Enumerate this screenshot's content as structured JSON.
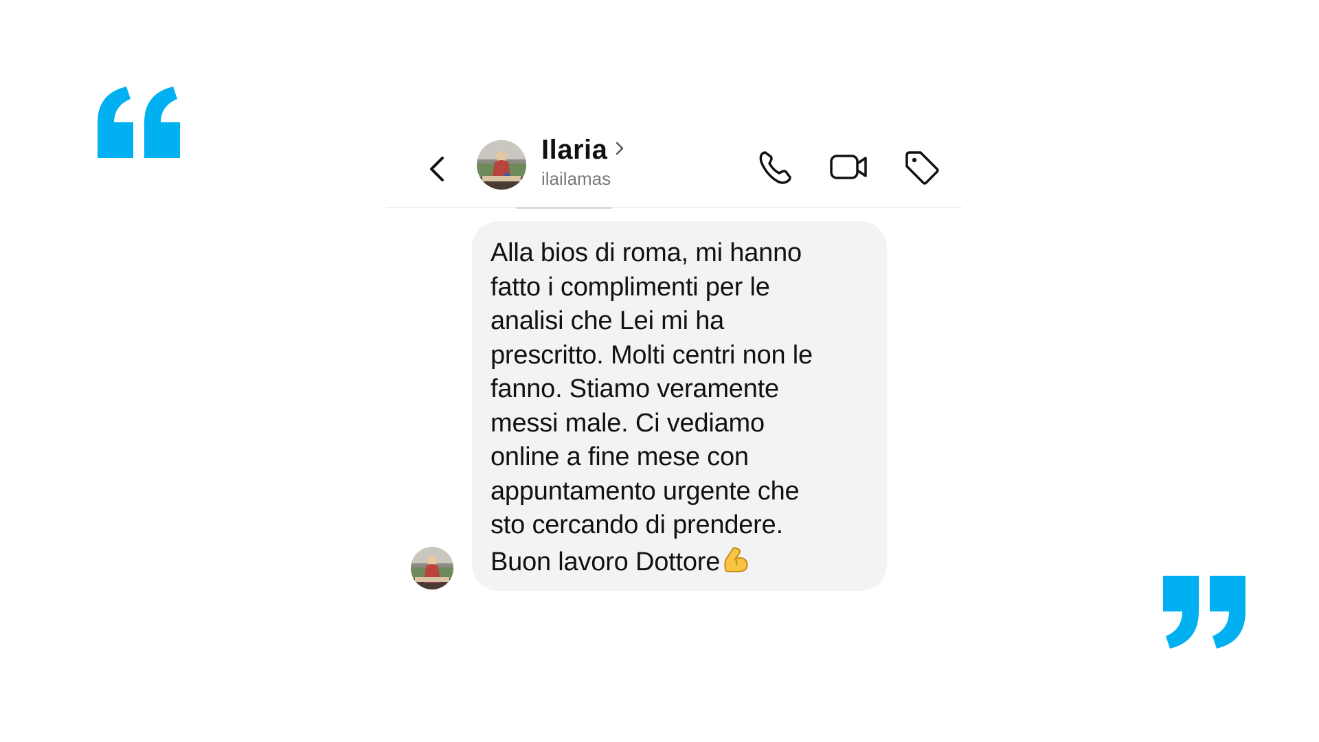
{
  "header": {
    "contact_name": "Ilaria",
    "contact_username": "ilailamas",
    "icons": {
      "back": "chevron-left-icon",
      "profile_link": "chevron-right-icon",
      "call": "phone-icon",
      "video": "video-camera-icon",
      "tag": "tag-icon"
    }
  },
  "message": {
    "text": "Alla bios di roma, mi hanno\nfatto i complimenti per le\nanalisi che Lei mi ha\nprescritto. Molti centri non le\nfanno. Stiamo veramente\nmessi male. Ci vediamo\nonline a fine mese con\nappuntamento urgente che\nsto cercando di prendere.\nBuon lavoro Dottore",
    "emoji": "flexed-biceps-emoji"
  },
  "decor": {
    "quote_color": "#00b0f0",
    "open_quote": "open-quote-icon",
    "close_quote": "close-quote-icon"
  },
  "colors": {
    "bubble": "#f2f3f5",
    "text": "#111111",
    "secondary_text": "#7a7a7a"
  }
}
